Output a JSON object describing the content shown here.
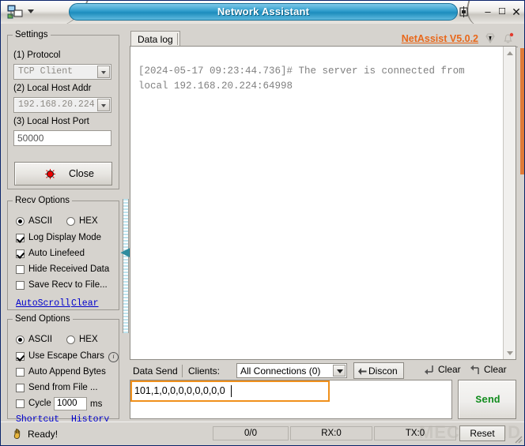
{
  "window": {
    "title": "Network Assistant",
    "app_icon": "network-computers-icon",
    "menu_arrow": "chevron-down-icon",
    "pin": "pin-icon",
    "minimize": "–",
    "maximize": "☐",
    "close": "✕"
  },
  "settings": {
    "group_label": "Settings",
    "protocol_label": "(1) Protocol",
    "protocol_value": "TCP Client",
    "host_addr_label": "(2) Local Host Addr",
    "host_addr_value": "192.168.20.224",
    "host_port_label": "(3) Local Host Port",
    "host_port_value": "50000",
    "connect_button": "Close",
    "led_state": "red"
  },
  "recv_options": {
    "group_label": "Recv Options",
    "ascii_label": "ASCII",
    "hex_label": "HEX",
    "mode_selected": "ASCII",
    "items": [
      {
        "label": "Log Display Mode",
        "checked": true
      },
      {
        "label": "Auto Linefeed",
        "checked": true
      },
      {
        "label": "Hide Received Data",
        "checked": false
      },
      {
        "label": "Save Recv to File...",
        "checked": false
      }
    ],
    "autoscroll_link": "AutoScroll",
    "clear_link": "Clear"
  },
  "send_options": {
    "group_label": "Send Options",
    "ascii_label": "ASCII",
    "hex_label": "HEX",
    "mode_selected": "ASCII",
    "items": [
      {
        "label": "Use Escape Chars",
        "checked": true,
        "info": true
      },
      {
        "label": "Auto Append Bytes",
        "checked": false
      },
      {
        "label": "Send from File ...",
        "checked": false
      }
    ],
    "cycle_label": "Cycle",
    "cycle_checked": false,
    "cycle_value": "1000",
    "cycle_unit": "ms",
    "shortcut_link": "Shortcut",
    "history_link": "History"
  },
  "main": {
    "tab_label": "Data log",
    "brand": "NetAssist V5.0.2",
    "gem_icon": "gem-icon",
    "bell_icon": "bell-icon",
    "log_text": "[2024-05-17 09:23:44.736]# The server is connected from local 192.168.20.224:64998"
  },
  "sendbar": {
    "data_send_label": "Data Send",
    "clients_label": "Clients:",
    "connections_value": "All Connections (0)",
    "discon_button": "Discon",
    "clear_recv_button": "Clear",
    "clear_send_button": "Clear",
    "input_value": "101,1,0,0,0,0,0,0,0,0",
    "send_button": "Send"
  },
  "statusbar": {
    "status_text": "Ready!",
    "counter": "0/0",
    "rx": "RX:0",
    "tx": "TX:0",
    "reset_button": "Reset",
    "watermark": "MECHMIND"
  },
  "colors": {
    "title_pill": "#2f9dcb",
    "brand_orange": "#e8681b",
    "focus_orange": "#f0901b",
    "send_green": "#128c1e",
    "link_blue": "#0000cc",
    "accent_teal": "#2e8c9e"
  }
}
